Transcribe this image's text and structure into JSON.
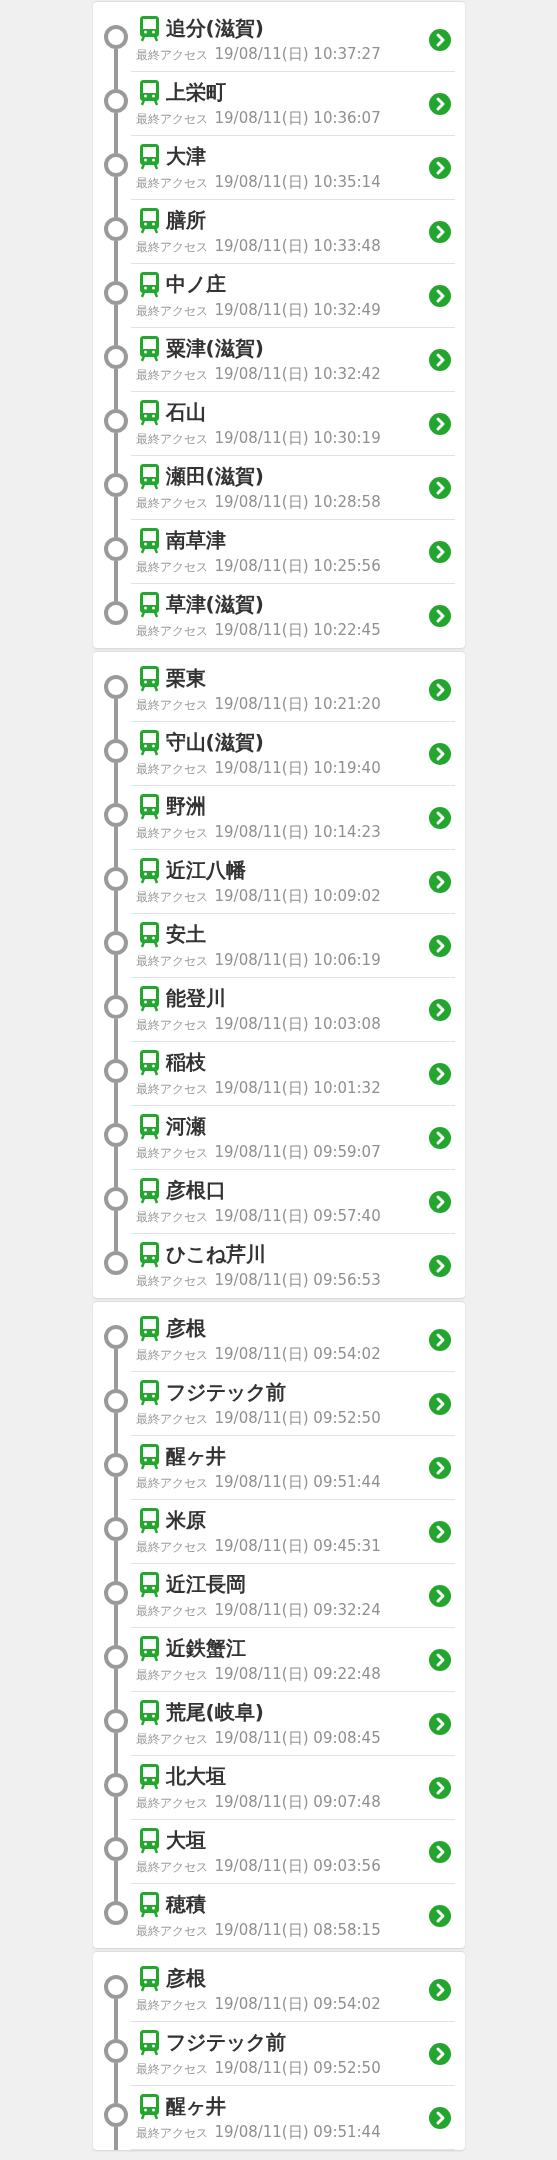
{
  "cards": [
    {
      "cut_off": false,
      "stations": [
        {
          "name": "追分(滋賀)",
          "label": "最終アクセス",
          "accessed": "19/08/11(日) 10:37:27"
        },
        {
          "name": "上栄町",
          "label": "最終アクセス",
          "accessed": "19/08/11(日) 10:36:07"
        },
        {
          "name": "大津",
          "label": "最終アクセス",
          "accessed": "19/08/11(日) 10:35:14"
        },
        {
          "name": "膳所",
          "label": "最終アクセス",
          "accessed": "19/08/11(日) 10:33:48"
        },
        {
          "name": "中ノ庄",
          "label": "最終アクセス",
          "accessed": "19/08/11(日) 10:32:49"
        },
        {
          "name": "粟津(滋賀)",
          "label": "最終アクセス",
          "accessed": "19/08/11(日) 10:32:42"
        },
        {
          "name": "石山",
          "label": "最終アクセス",
          "accessed": "19/08/11(日) 10:30:19"
        },
        {
          "name": "瀬田(滋賀)",
          "label": "最終アクセス",
          "accessed": "19/08/11(日) 10:28:58"
        },
        {
          "name": "南草津",
          "label": "最終アクセス",
          "accessed": "19/08/11(日) 10:25:56"
        },
        {
          "name": "草津(滋賀)",
          "label": "最終アクセス",
          "accessed": "19/08/11(日) 10:22:45"
        }
      ]
    },
    {
      "cut_off": false,
      "stations": [
        {
          "name": "栗東",
          "label": "最終アクセス",
          "accessed": "19/08/11(日) 10:21:20"
        },
        {
          "name": "守山(滋賀)",
          "label": "最終アクセス",
          "accessed": "19/08/11(日) 10:19:40"
        },
        {
          "name": "野洲",
          "label": "最終アクセス",
          "accessed": "19/08/11(日) 10:14:23"
        },
        {
          "name": "近江八幡",
          "label": "最終アクセス",
          "accessed": "19/08/11(日) 10:09:02"
        },
        {
          "name": "安土",
          "label": "最終アクセス",
          "accessed": "19/08/11(日) 10:06:19"
        },
        {
          "name": "能登川",
          "label": "最終アクセス",
          "accessed": "19/08/11(日) 10:03:08"
        },
        {
          "name": "稲枝",
          "label": "最終アクセス",
          "accessed": "19/08/11(日) 10:01:32"
        },
        {
          "name": "河瀬",
          "label": "最終アクセス",
          "accessed": "19/08/11(日) 09:59:07"
        },
        {
          "name": "彦根口",
          "label": "最終アクセス",
          "accessed": "19/08/11(日) 09:57:40"
        },
        {
          "name": "ひこね芹川",
          "label": "最終アクセス",
          "accessed": "19/08/11(日) 09:56:53"
        }
      ]
    },
    {
      "cut_off": false,
      "stations": [
        {
          "name": "彦根",
          "label": "最終アクセス",
          "accessed": "19/08/11(日) 09:54:02"
        },
        {
          "name": "フジテック前",
          "label": "最終アクセス",
          "accessed": "19/08/11(日) 09:52:50"
        },
        {
          "name": "醒ヶ井",
          "label": "最終アクセス",
          "accessed": "19/08/11(日) 09:51:44"
        },
        {
          "name": "米原",
          "label": "最終アクセス",
          "accessed": "19/08/11(日) 09:45:31"
        },
        {
          "name": "近江長岡",
          "label": "最終アクセス",
          "accessed": "19/08/11(日) 09:32:24"
        },
        {
          "name": "近鉄蟹江",
          "label": "最終アクセス",
          "accessed": "19/08/11(日) 09:22:48"
        },
        {
          "name": "荒尾(岐阜)",
          "label": "最終アクセス",
          "accessed": "19/08/11(日) 09:08:45"
        },
        {
          "name": "北大垣",
          "label": "最終アクセス",
          "accessed": "19/08/11(日) 09:07:48"
        },
        {
          "name": "大垣",
          "label": "最終アクセス",
          "accessed": "19/08/11(日) 09:03:56"
        },
        {
          "name": "穂積",
          "label": "最終アクセス",
          "accessed": "19/08/11(日) 08:58:15"
        }
      ]
    },
    {
      "cut_off": true,
      "stations": [
        {
          "name": "彦根",
          "label": "最終アクセス",
          "accessed": "19/08/11(日) 09:54:02"
        },
        {
          "name": "フジテック前",
          "label": "最終アクセス",
          "accessed": "19/08/11(日) 09:52:50"
        },
        {
          "name": "醒ヶ井",
          "label": "最終アクセス",
          "accessed": "19/08/11(日) 09:51:44"
        }
      ]
    }
  ]
}
